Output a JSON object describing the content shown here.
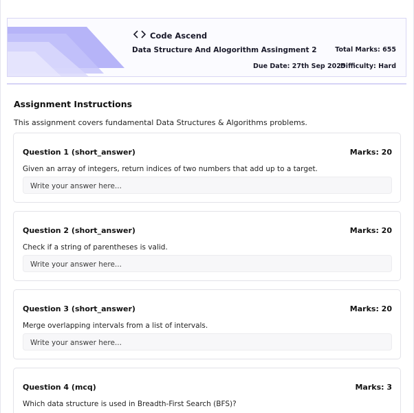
{
  "header": {
    "brand": "Code Ascend",
    "brand_icon": "code-brackets-icon",
    "title": "Data Structure And Alogorithm Assingment 2",
    "total_marks": "Total Marks: 655",
    "due_date": "Due Date: 27th Sep 2025",
    "difficulty": "Difficulty: Hard",
    "accent_color": "#8f8ef5"
  },
  "instructions": {
    "heading": "Assignment Instructions",
    "text": "This assignment covers fundamental Data Structures & Algorithms problems."
  },
  "questions": [
    {
      "title": "Question 1 (short_answer)",
      "marks": "Marks: 20",
      "text": "Given an array of integers, return indices of two numbers that add up to a target.",
      "placeholder": "Write your answer here..."
    },
    {
      "title": "Question 2 (short_answer)",
      "marks": "Marks: 20",
      "text": "Check if a string of parentheses is valid.",
      "placeholder": "Write your answer here..."
    },
    {
      "title": "Question 3 (short_answer)",
      "marks": "Marks: 20",
      "text": "Merge overlapping intervals from a list of intervals.",
      "placeholder": "Write your answer here..."
    },
    {
      "title": "Question 4 (mcq)",
      "marks": "Marks: 3",
      "text": "Which data structure is used in Breadth-First Search (BFS)?"
    }
  ]
}
